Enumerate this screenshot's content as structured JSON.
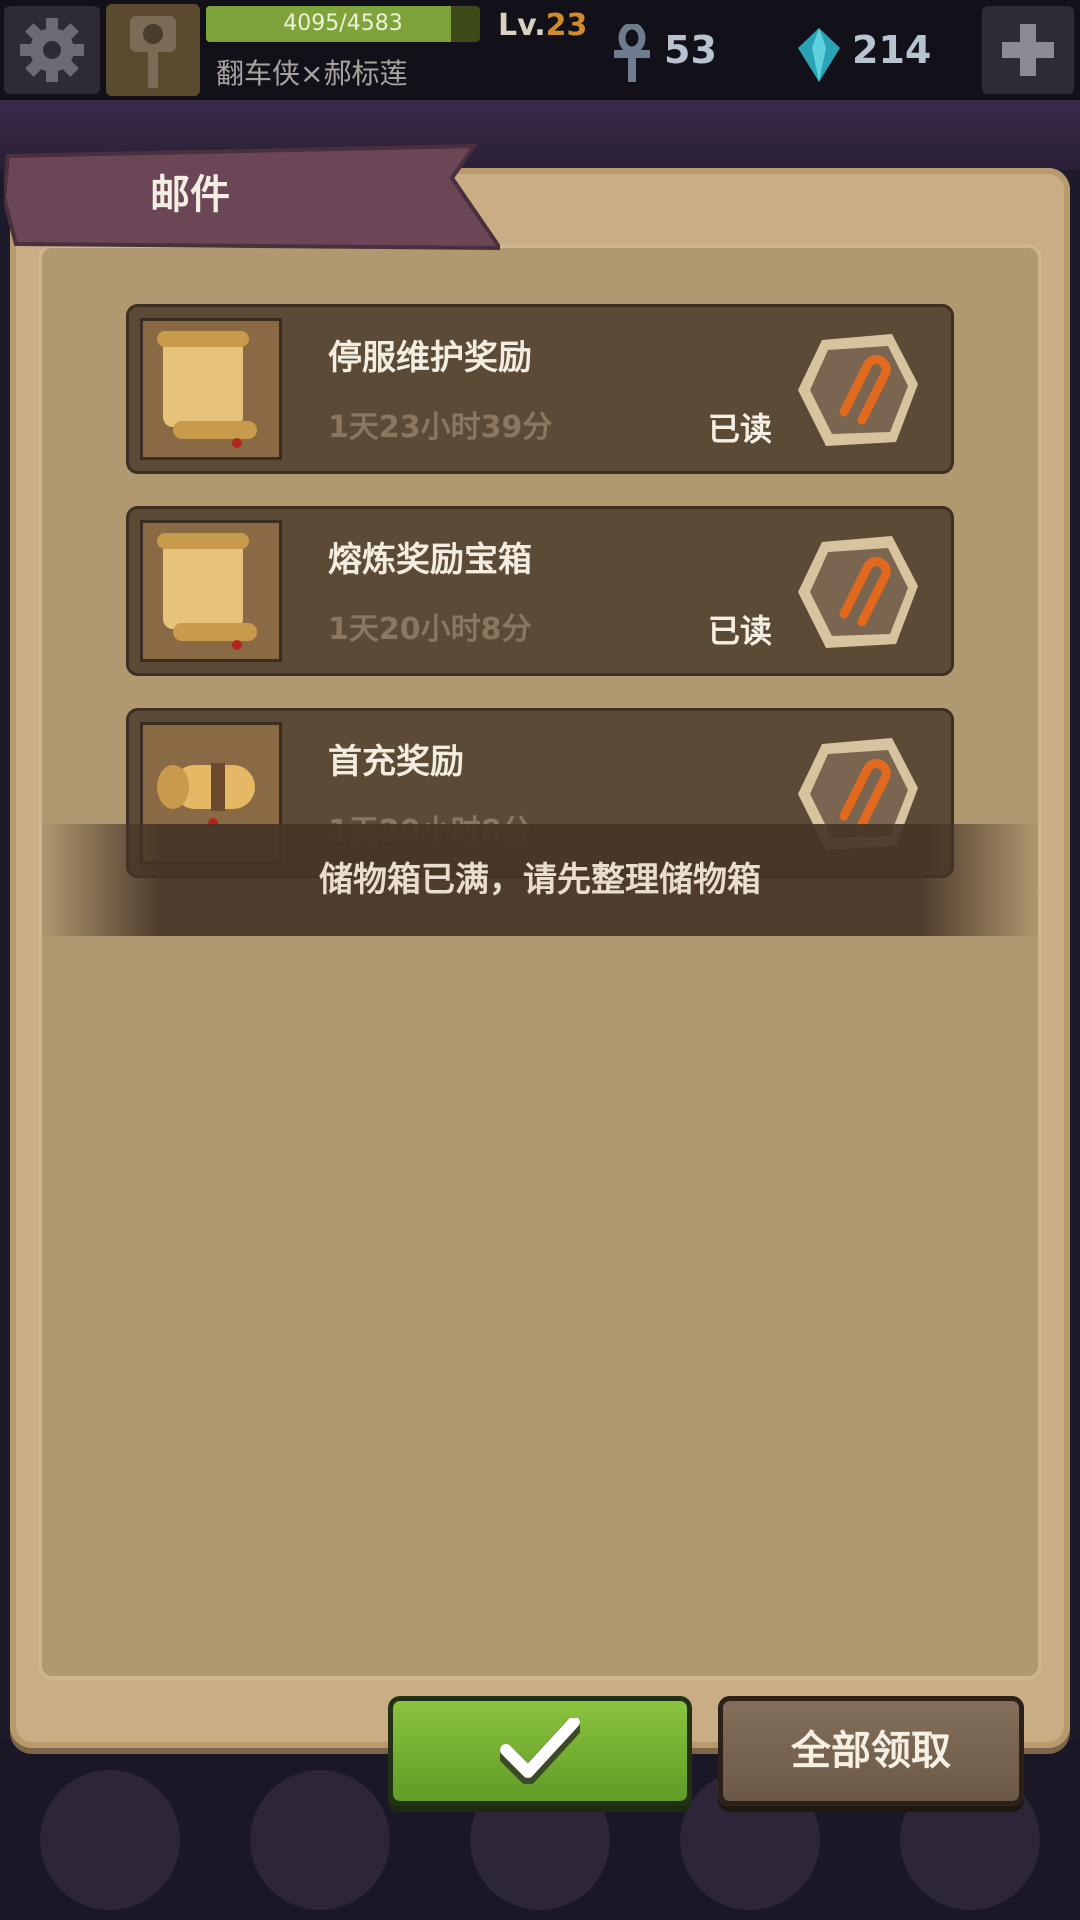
{
  "topbar": {
    "xp_text": "4095/4583",
    "xp_fraction": 0.8935,
    "level_prefix": "Lv.",
    "level": "23",
    "player_name": "翻车侠×郝标莲",
    "ankh_count": "53",
    "gem_count": "214",
    "icons": [
      "gear-icon",
      "ankh-icon",
      "gem-icon",
      "plus-icon"
    ]
  },
  "panel": {
    "title": "邮件"
  },
  "mails": [
    {
      "title": "停服维护奖励",
      "time": "1天23小时39分",
      "status": "已读",
      "icon": "scroll-open-icon"
    },
    {
      "title": "熔炼奖励宝箱",
      "time": "1天20小时8分",
      "status": "已读",
      "icon": "scroll-open-icon"
    },
    {
      "title": "首充奖励",
      "time": "1天20小时8分",
      "status": "",
      "icon": "scroll-rolled-icon"
    }
  ],
  "toast": {
    "message": "储物箱已满，请先整理储物箱"
  },
  "buttons": {
    "confirm_icon": "check-icon",
    "claim_all_label": "全部领取"
  },
  "colors": {
    "confirm_green": "#8cc63f",
    "panel_tan": "#c9ad85",
    "mail_bg": "#5b4a35",
    "ribbon": "#6b4656"
  }
}
